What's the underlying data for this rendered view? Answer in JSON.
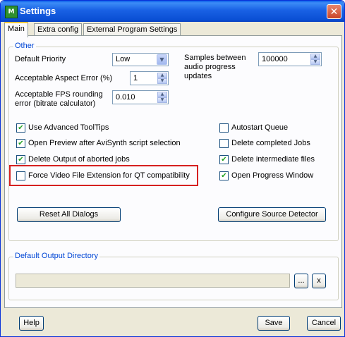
{
  "window": {
    "title": "Settings",
    "app_icon": "MeGUI-icon",
    "close_glyph": "✕"
  },
  "tabs": [
    {
      "label": "Main",
      "active": true
    },
    {
      "label": "Extra config",
      "active": false
    },
    {
      "label": "External Program Settings",
      "active": false
    }
  ],
  "other_group": {
    "legend": "Other",
    "default_priority": {
      "label": "Default Priority",
      "value": "Low"
    },
    "aspect_error": {
      "label": "Acceptable Aspect Error (%)",
      "value": "1"
    },
    "fps_rounding": {
      "label": "Acceptable FPS rounding error (bitrate calculator)",
      "value": "0.010"
    },
    "samples_between": {
      "label": "Samples between audio progress updates",
      "value": "100000"
    },
    "checkboxes_left": [
      {
        "label": "Use Advanced ToolTips",
        "checked": true
      },
      {
        "label": "Open Preview after AviSynth script selection",
        "checked": true
      },
      {
        "label": "Delete Output of aborted jobs",
        "checked": true
      },
      {
        "label": "Force Video File Extension for QT compatibility",
        "checked": false
      }
    ],
    "checkboxes_right": [
      {
        "label": "Autostart Queue",
        "checked": false
      },
      {
        "label": "Delete completed Jobs",
        "checked": false
      },
      {
        "label": "Delete intermediate files",
        "checked": true
      },
      {
        "label": "Open Progress Window",
        "checked": true
      }
    ],
    "reset_button": "Reset All Dialogs",
    "configure_button": "Configure Source Detector"
  },
  "output_group": {
    "legend": "Default Output Directory",
    "path_value": "",
    "browse_button": "...",
    "clear_button": "x"
  },
  "footer": {
    "help": "Help",
    "save": "Save",
    "cancel": "Cancel"
  },
  "check_glyph": "✔",
  "colors": {
    "highlight": "#d62020",
    "legend": "#0046d5",
    "check": "#21a121"
  }
}
